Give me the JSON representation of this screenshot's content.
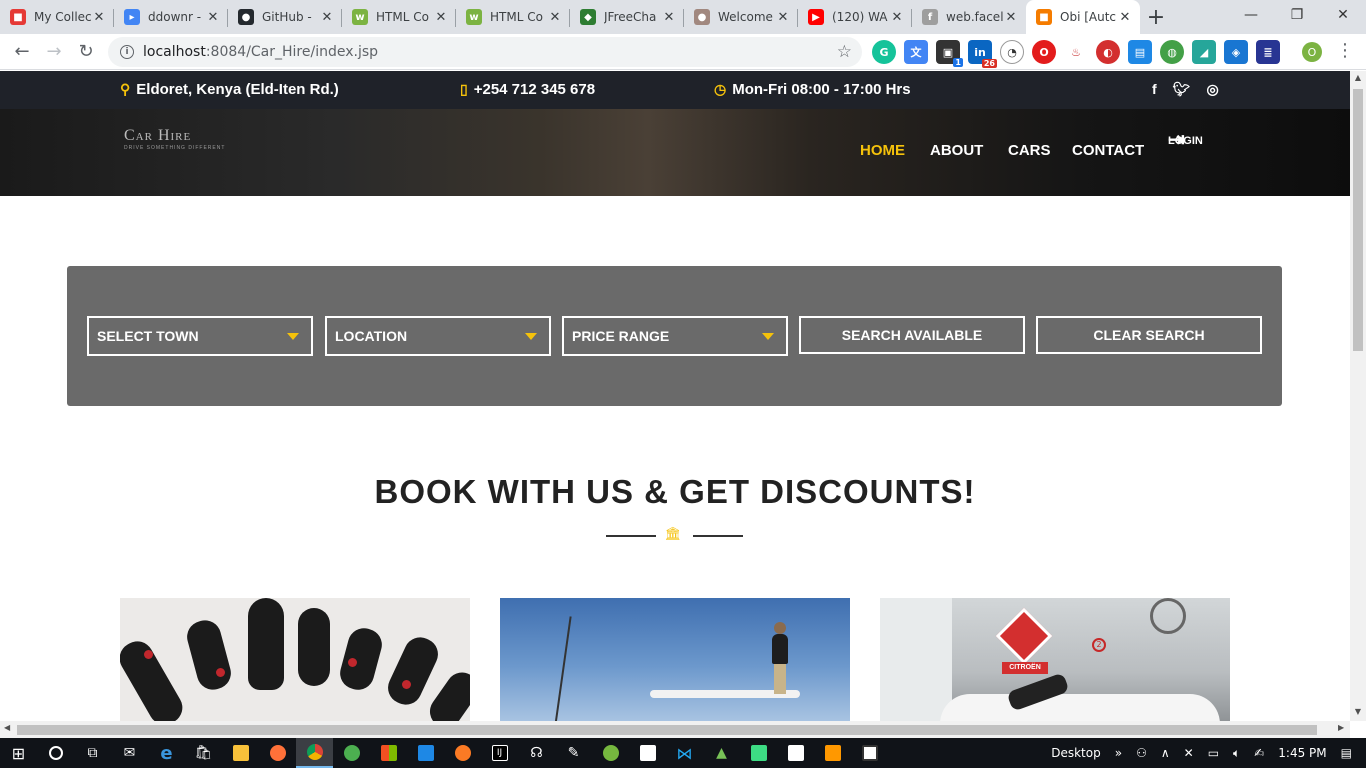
{
  "browser": {
    "tabs": [
      {
        "label": "My Collec",
        "favicon_color": "#e53935",
        "favicon": "■"
      },
      {
        "label": "ddownr -",
        "favicon_color": "#4285f4",
        "favicon": "▸"
      },
      {
        "label": "GitHub -",
        "favicon_color": "#24292e",
        "favicon": "●"
      },
      {
        "label": "HTML Co",
        "favicon_color": "#7cb342",
        "favicon": "w"
      },
      {
        "label": "HTML Co",
        "favicon_color": "#7cb342",
        "favicon": "w"
      },
      {
        "label": "JFreeCha",
        "favicon_color": "#2e7d32",
        "favicon": "◆"
      },
      {
        "label": "Welcome",
        "favicon_color": "#a1887f",
        "favicon": "●"
      },
      {
        "label": "(120) WA",
        "favicon_color": "#ff0000",
        "favicon": "▶"
      },
      {
        "label": "web.facel",
        "favicon_color": "#9e9e9e",
        "favicon": "f"
      },
      {
        "label": "Obi [Autc",
        "favicon_color": "#f57c00",
        "favicon": "■",
        "active": true
      }
    ],
    "new_tab": "+",
    "controls": {
      "minimize": "—",
      "maximize": "❐",
      "close": "✕"
    },
    "url_host": "localhost",
    "url_rest": ":8084/Car_Hire/index.jsp",
    "profile_initial": "O",
    "extension_badges": {
      "badge1": "1",
      "badge2": "26"
    }
  },
  "site": {
    "top_bar": {
      "address": "Eldoret, Kenya (Eld-Iten Rd.)",
      "phone": "+254 712 345 678",
      "hours": "Mon-Fri 08:00 - 17:00 Hrs",
      "social_icons": [
        "facebook-icon",
        "twitter-icon",
        "instagram-icon"
      ]
    },
    "logo": {
      "text": "Car Hire",
      "tagline": "DRIVE SOMETHING DIFFERENT"
    },
    "nav": {
      "home": "HOME",
      "about": "ABOUT",
      "cars": "CARS",
      "contact": "CONTACT",
      "login": "LOGIN"
    },
    "search": {
      "town": "SELECT TOWN",
      "location": "LOCATION",
      "price": "PRICE RANGE",
      "search_btn": "SEARCH AVAILABLE",
      "clear_btn": "CLEAR SEARCH"
    },
    "heading": "BOOK WITH US & GET DISCOUNTS!",
    "cards": [
      {
        "name": "car keys"
      },
      {
        "name": "boat ride"
      },
      {
        "name": "garage"
      }
    ],
    "card3_sign": "CITROËN",
    "accent_color": "#f5c20b"
  },
  "taskbar": {
    "desktop_label": "Desktop",
    "time": "1:45 PM"
  }
}
